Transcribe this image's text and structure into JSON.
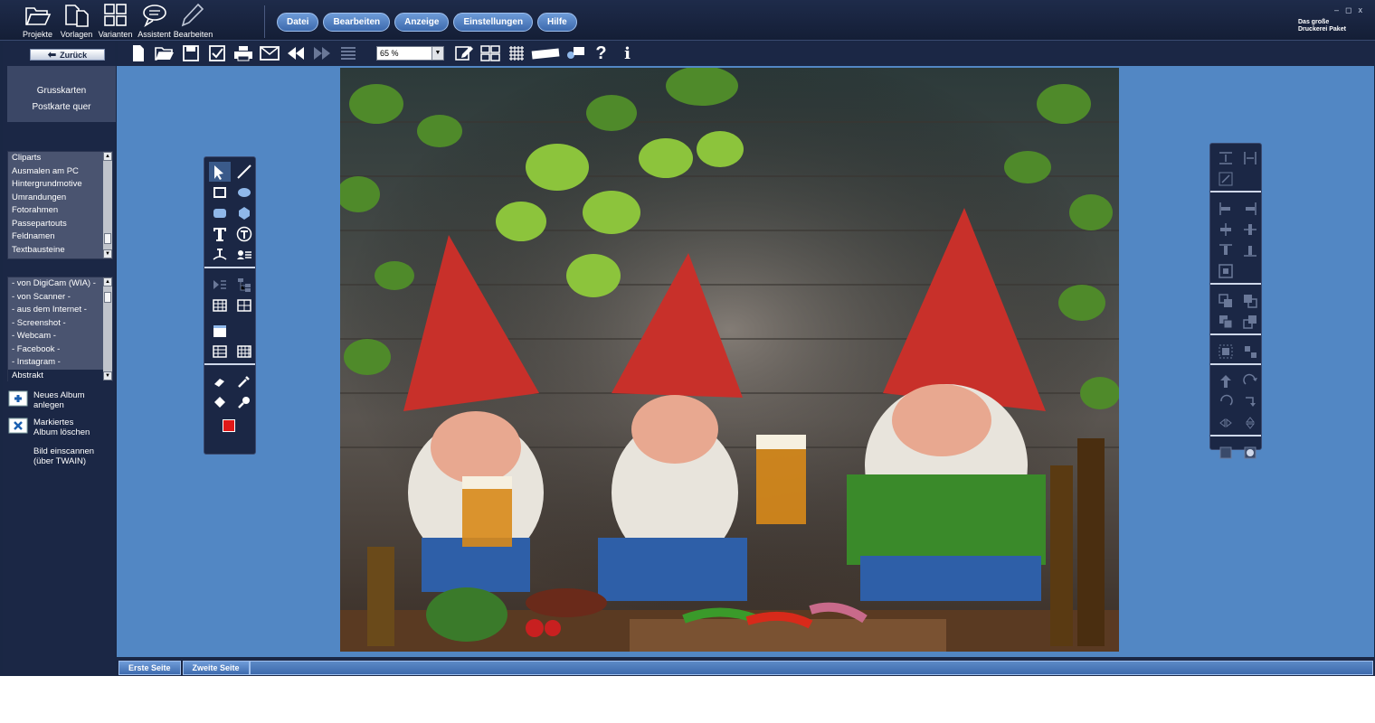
{
  "topbar": {
    "tools": [
      {
        "label": "Projekte",
        "icon": "folder-open-icon"
      },
      {
        "label": "Vorlagen",
        "icon": "documents-icon"
      },
      {
        "label": "Varianten",
        "icon": "grid-icon"
      },
      {
        "label": "Assistent",
        "icon": "speech-bubble-icon"
      },
      {
        "label": "Bearbeiten",
        "icon": "pencil-icon"
      }
    ],
    "menus": [
      "Datei",
      "Bearbeiten",
      "Anzeige",
      "Einstellungen",
      "Hilfe"
    ],
    "app_title_line1": "Das große",
    "app_title_line2": "Druckerei Paket",
    "win_min": "–",
    "win_max": "◻",
    "win_close": "x"
  },
  "sidebar": {
    "back_label": "Zurück",
    "template_line1": "Grusskarten",
    "template_line2": "Postkarte quer",
    "categories": [
      "Cliparts",
      "Ausmalen am PC",
      "Hintergrundmotive",
      "Umrandungen",
      "Fotorahmen",
      "Passepartouts",
      "Feldnamen",
      "Textbausteine"
    ],
    "sources": [
      "- von DigiCam (WIA) -",
      "- von Scanner -",
      "- aus dem Internet -",
      "- Screenshot -",
      "- Webcam -",
      "- Facebook -",
      "- Instagram -",
      "Abstrakt"
    ],
    "actions": [
      {
        "line1": "Neues Album",
        "line2": "anlegen"
      },
      {
        "line1": "Markiertes",
        "line2": "Album löschen"
      },
      {
        "line1": "Bild einscannen",
        "line2": "(über TWAIN)"
      }
    ]
  },
  "toolbar": {
    "zoom_value": "65 %"
  },
  "colors": {
    "canvas_bg": "#5287c4",
    "panel_bg": "#1b2745",
    "accent": "#3d6aad",
    "current_color": "#e01818"
  },
  "pages": {
    "tabs": [
      "Erste Seite",
      "Zweite Seite"
    ]
  }
}
